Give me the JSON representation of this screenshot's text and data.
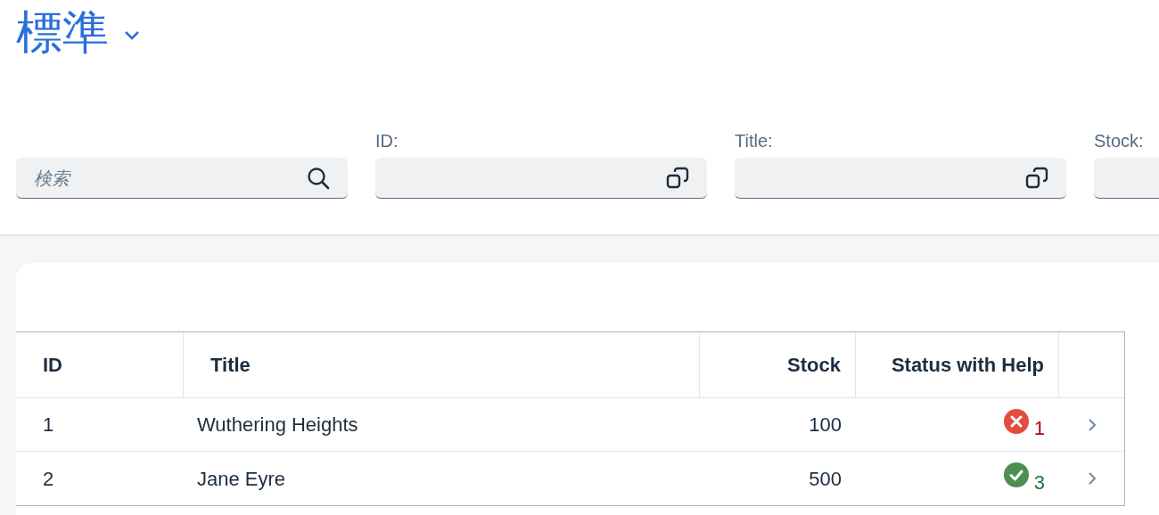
{
  "header": {
    "title": "標準"
  },
  "filters": [
    {
      "kind": "search",
      "placeholder": "検索"
    },
    {
      "kind": "valuehelp",
      "label": "ID:"
    },
    {
      "kind": "valuehelp",
      "label": "Title:"
    },
    {
      "kind": "valuehelp",
      "label": "Stock:"
    }
  ],
  "table": {
    "columns": [
      {
        "label": "ID"
      },
      {
        "label": "Title"
      },
      {
        "label": "Stock"
      },
      {
        "label": "Status with Help"
      }
    ],
    "rows": [
      {
        "id": "1",
        "title": "Wuthering Heights",
        "stock": "100",
        "status": {
          "kind": "error",
          "value": "1"
        }
      },
      {
        "id": "2",
        "title": "Jane Eyre",
        "stock": "500",
        "status": {
          "kind": "success",
          "value": "3"
        }
      }
    ]
  }
}
